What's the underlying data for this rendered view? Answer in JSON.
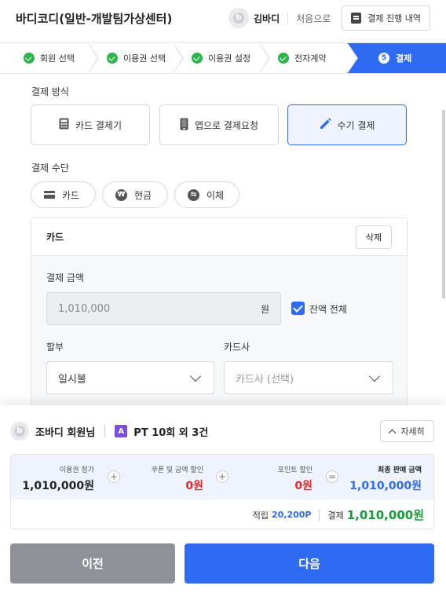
{
  "header": {
    "title": "바디코디(일반-개발팀가상센터)",
    "logo_letter": "b",
    "user_name": "김바디",
    "restart_label": "처음으로",
    "progress_label": "결제 진행 내역"
  },
  "steps": [
    {
      "label": "회원 선택",
      "status": "done"
    },
    {
      "label": "이용권 선택",
      "status": "done"
    },
    {
      "label": "이용권 설정",
      "status": "done"
    },
    {
      "label": "전자계약",
      "status": "done"
    },
    {
      "label": "결제",
      "status": "active",
      "number": "5"
    }
  ],
  "payment_method": {
    "label": "결제 방식",
    "options": [
      {
        "label": "카드 결제기",
        "icon": "calculator-icon"
      },
      {
        "label": "앱으로 결제요청",
        "icon": "phone-icon"
      },
      {
        "label": "수기 결제",
        "icon": "pencil-icon",
        "selected": true
      }
    ]
  },
  "payment_means": {
    "label": "결제 수단",
    "options": [
      {
        "label": "카드",
        "icon": "card-icon",
        "glyph": ""
      },
      {
        "label": "현금",
        "icon": "won-icon",
        "glyph": "₩"
      },
      {
        "label": "이체",
        "icon": "transfer-icon",
        "glyph": "⇆"
      }
    ]
  },
  "card_panel": {
    "title": "카드",
    "delete_label": "삭제",
    "amount_label": "결제 금액",
    "amount_value": "1,010,000",
    "amount_unit": "원",
    "full_balance_label": "잔액 전체",
    "full_balance_checked": true,
    "installment_label": "할부",
    "installment_value": "일시불",
    "card_company_label": "카드사",
    "card_company_placeholder": "카드사 (선택)"
  },
  "order": {
    "member_name": "조바디 회원님",
    "product_badge": "A",
    "product_summary": "PT 10회 외 3건",
    "detail_label": "자세히"
  },
  "summary": {
    "ticket_price_label": "이용권 정가",
    "ticket_price": "1,010,000원",
    "coupon_label": "쿠폰 및 금액 할인",
    "coupon_value": "0원",
    "point_label": "포인트 할인",
    "point_value": "0원",
    "final_label": "최종 판매 금액",
    "final_value": "1,010,000원",
    "plus": "+",
    "equals": "=",
    "earn_label": "적립",
    "earn_value": "20,200P",
    "pay_label": "결제",
    "pay_value": "1,010,000원",
    "colors": {
      "discount": "#e8262b",
      "final": "#2f6bf2",
      "pay": "#1a9b3a"
    }
  },
  "footer": {
    "prev_label": "이전",
    "next_label": "다음"
  }
}
